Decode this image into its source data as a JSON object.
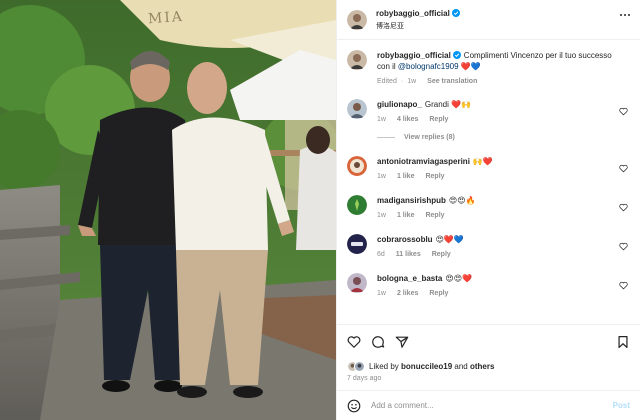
{
  "post": {
    "author": "robybaggio_official",
    "location": "博洛尼亚",
    "photo_text": "MIA",
    "caption": {
      "username": "robybaggio_official",
      "text": "Complimenti Vincenzo per il tuo successo con il",
      "mention": "@bolognafc1909",
      "emoji": "❤️💙",
      "edited": "Edited",
      "dot": "·",
      "time": "1w",
      "see_translation": "See translation"
    },
    "comments": [
      {
        "username": "giulionapo_",
        "text": "Grandi ❤️🙌",
        "time": "1w",
        "likes": "4 likes",
        "reply": "Reply"
      },
      {
        "username": "antoniotramviagasperini",
        "text": "🙌❤️",
        "time": "1w",
        "likes": "1 like",
        "reply": "Reply"
      },
      {
        "username": "madigansirishpub",
        "text": "😍😍🔥",
        "time": "1w",
        "likes": "1 like",
        "reply": "Reply"
      },
      {
        "username": "cobrarossoblu",
        "text": "😍❤️💙",
        "time": "6d",
        "likes": "11 likes",
        "reply": "Reply"
      },
      {
        "username": "bologna_e_basta",
        "text": "😍😍❤️",
        "time": "1w",
        "likes": "2 likes",
        "reply": "Reply"
      }
    ],
    "view_replies": "View replies (8)",
    "liked_by": {
      "prefix": "Liked by",
      "user": "bonuccileo19",
      "conj": "and",
      "others": "others"
    },
    "date": "7 days ago",
    "add_comment": {
      "placeholder": "Add a comment...",
      "post_label": "Post"
    }
  },
  "icons": {
    "verified": "verified-badge-icon",
    "heart": "heart-icon",
    "comment": "comment-icon",
    "share": "share-icon",
    "bookmark": "bookmark-icon",
    "emoji": "emoji-icon",
    "more": "more-options-icon"
  },
  "colors": {
    "link": "#00376b",
    "verified": "#0095f6",
    "muted": "#8e8e8e",
    "post_disabled": "#b2dffc"
  }
}
